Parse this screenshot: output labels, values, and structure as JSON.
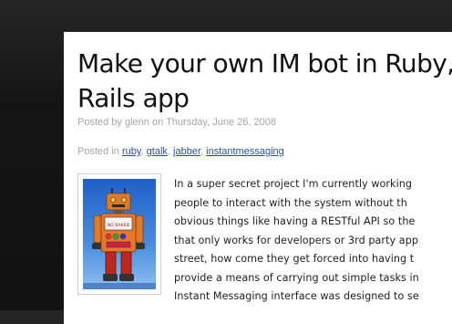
{
  "post": {
    "title_lines": [
      "Make your own IM bot in Ruby,",
      "Rails app"
    ],
    "posted_by_prefix": "Posted by",
    "author": "glenn",
    "date_prefix": "on",
    "date": "Thursday, June 26, 2008",
    "tags_prefix": "Posted in",
    "tags": [
      "ruby",
      "gtalk",
      "jabber",
      "instantmessaging"
    ],
    "tag_separator": ",",
    "image": {
      "icon": "toy-robot-photo",
      "sign_text": "NO BAKED"
    },
    "body_lines": [
      "In a super secret project I'm currently working",
      "people to interact with the system without th",
      "obvious things like having a RESTful API so the",
      "that only works for developers or 3rd party app",
      "street, how come they get forced into having t",
      "provide a means of carrying out simple tasks in",
      "Instant Messaging interface was designed to se"
    ]
  },
  "colors": {
    "background": "#1a1a1a",
    "panel": "#ffffff",
    "title": "#111111",
    "meta": "#a5a5a5",
    "link": "#2a4fa0",
    "sky": "#3b78d8",
    "robot_orange": "#e8762a"
  }
}
